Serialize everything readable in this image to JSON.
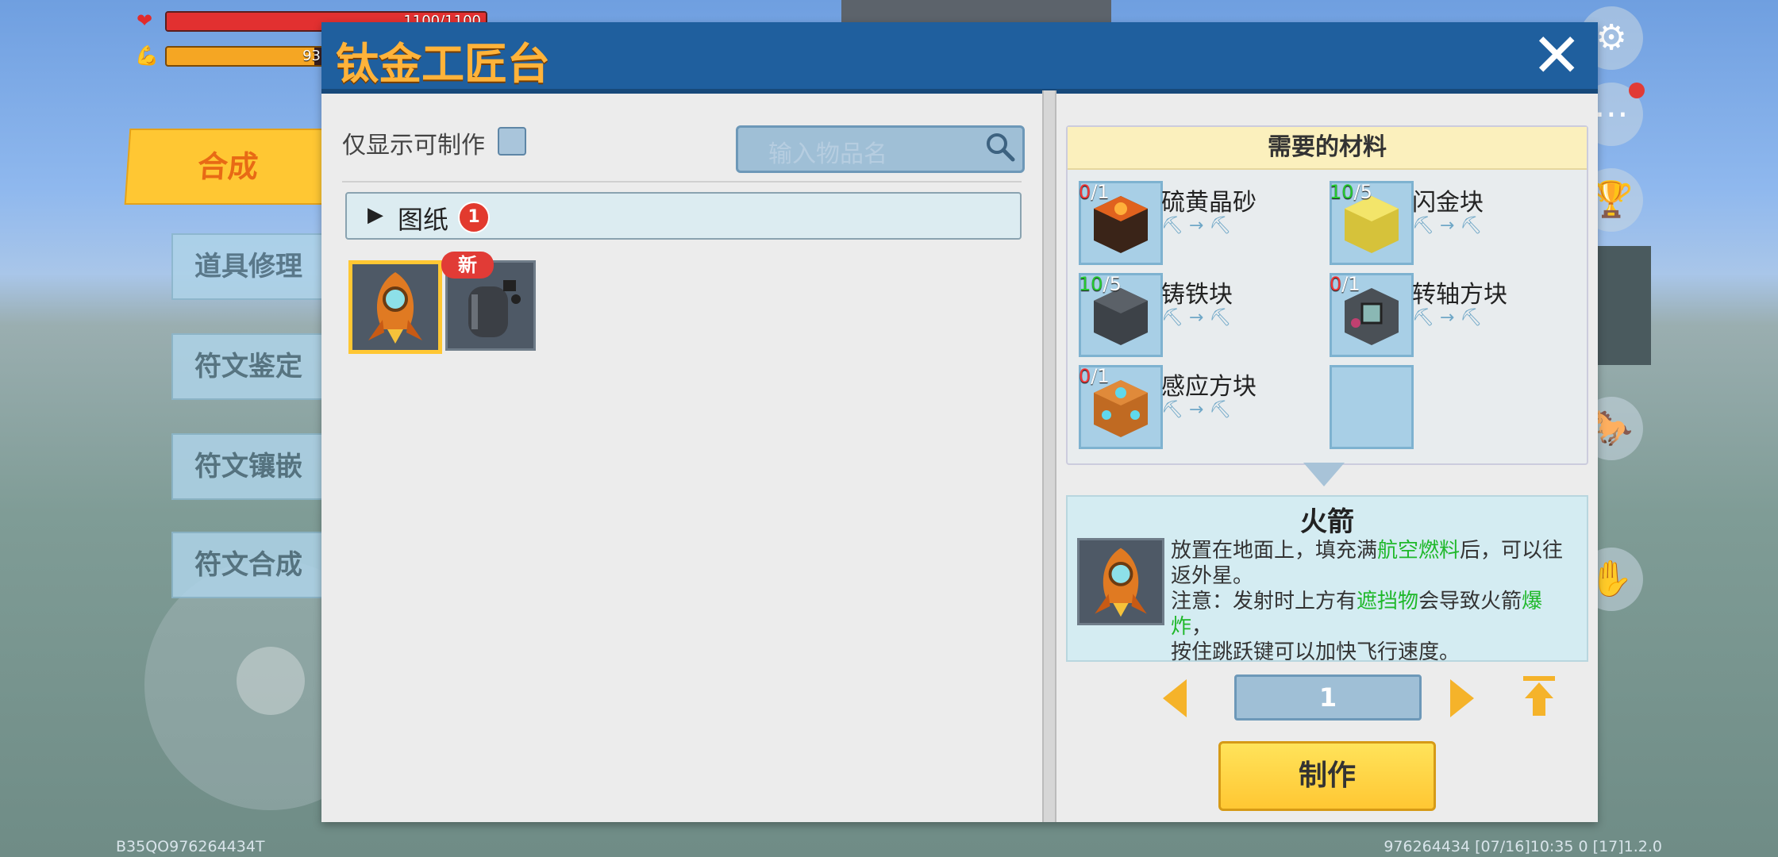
{
  "hud": {
    "health_text": "1100/1100",
    "health_fraction": 1.0,
    "hunger_text": "93",
    "hunger_fraction": 0.93
  },
  "side_tabs": [
    "合成",
    "道具修理",
    "符文鉴定",
    "符文镶嵌",
    "符文合成"
  ],
  "panel": {
    "title": "钛金工匠台",
    "close_label": "✕"
  },
  "left": {
    "only_craftable_label": "仅显示可制作",
    "search_placeholder": "输入物品名",
    "folder_label": "图纸",
    "folder_badge": "1",
    "items": [
      {
        "name": "rocket",
        "selected": true,
        "badge": ""
      },
      {
        "name": "fuel-tank",
        "selected": false,
        "badge": "新"
      }
    ]
  },
  "materials": {
    "header": "需要的材料",
    "items": [
      {
        "name": "硫黄晶砂",
        "have": "0",
        "need": "/1",
        "ok": false
      },
      {
        "name": "闪金块",
        "have": "10",
        "need": "/5",
        "ok": true
      },
      {
        "name": "铸铁块",
        "have": "10",
        "need": "/5",
        "ok": true
      },
      {
        "name": "转轴方块",
        "have": "0",
        "need": "/1",
        "ok": false
      },
      {
        "name": "感应方块",
        "have": "0",
        "need": "/1",
        "ok": false
      }
    ]
  },
  "result": {
    "title": "火箭",
    "desc_line1_a": "放置在地面上，填充满",
    "desc_line1_b": "航空燃料",
    "desc_line1_c": "后，可以往返外星。",
    "desc_line2_a": "注意：发射时上方有",
    "desc_line2_b": "遮挡物",
    "desc_line2_c": "会导致火箭",
    "desc_line2_d": "爆炸",
    "desc_line2_e": "，",
    "desc_line3": "按住跳跃键可以加快飞行速度。"
  },
  "quantity": "1",
  "make_label": "制作",
  "footer": {
    "left": "B35QO976264434T",
    "right": "976264434   [07/16]10:35 0   [17]1.2.0"
  },
  "colors": {
    "panel_header": "#1f5f9e",
    "title_orange": "#ffb33a",
    "accent_yellow": "#ffc733",
    "missing_red": "#f23535",
    "ok_green": "#25c92f"
  }
}
